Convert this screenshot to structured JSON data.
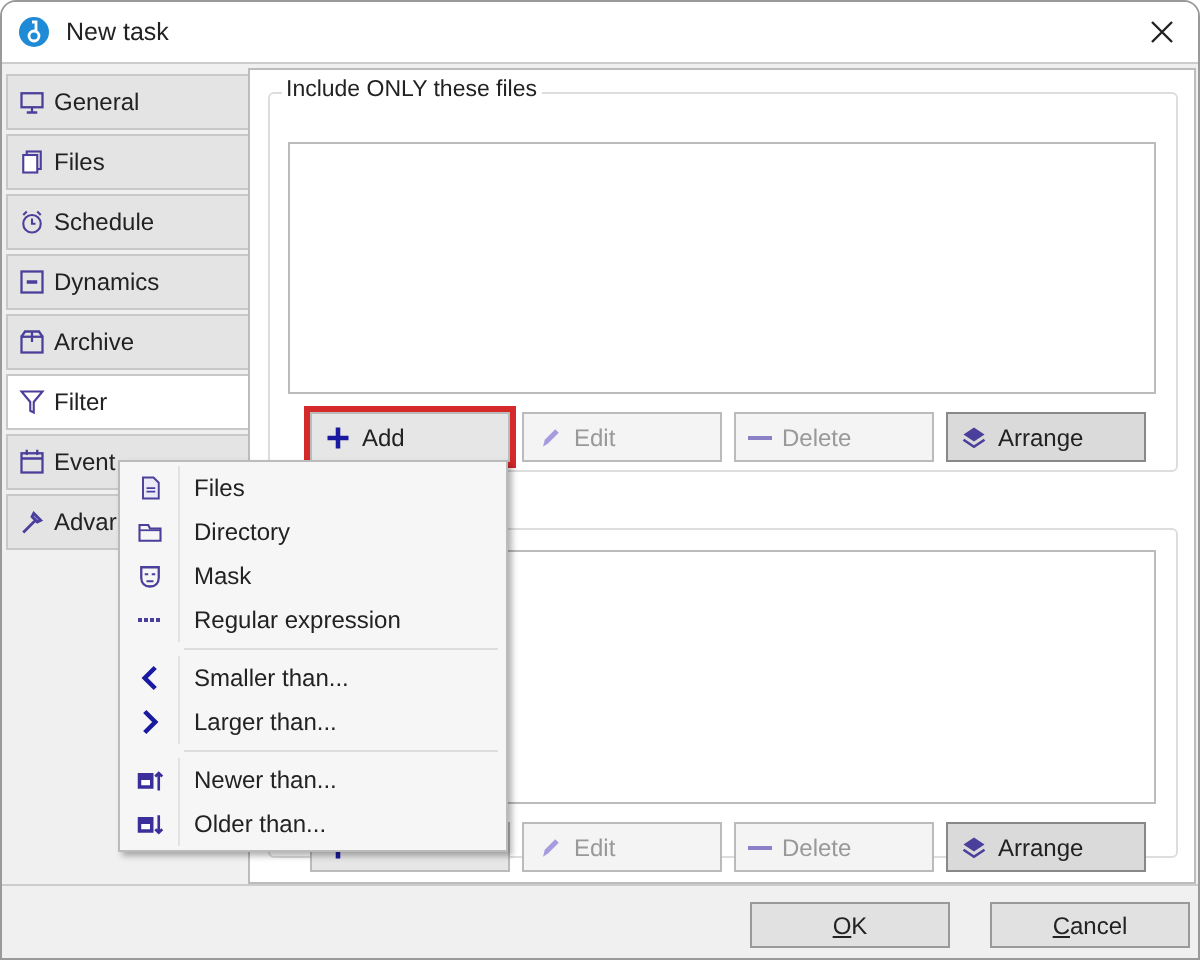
{
  "window": {
    "title": "New task"
  },
  "tabs": [
    {
      "label": "General",
      "selected": false
    },
    {
      "label": "Files",
      "selected": false
    },
    {
      "label": "Schedule",
      "selected": false
    },
    {
      "label": "Dynamics",
      "selected": false
    },
    {
      "label": "Archive",
      "selected": false
    },
    {
      "label": "Filter",
      "selected": true
    },
    {
      "label": "Event",
      "selected": false
    },
    {
      "label": "Advar",
      "selected": false
    }
  ],
  "include_group": {
    "title": "Include ONLY these files",
    "buttons": [
      {
        "label": "Add",
        "disabled": false,
        "highlighted": true
      },
      {
        "label": "Edit",
        "disabled": true,
        "highlighted": false
      },
      {
        "label": "Delete",
        "disabled": true,
        "highlighted": false
      },
      {
        "label": "Arrange",
        "disabled": false,
        "highlighted": false
      }
    ]
  },
  "second_group": {
    "buttons": [
      {
        "disabled": false,
        "highlighted": false
      },
      {
        "label": "Edit",
        "disabled": true,
        "highlighted": false
      },
      {
        "label": "Delete",
        "disabled": true,
        "highlighted": false
      },
      {
        "label": "Arrange",
        "disabled": false,
        "highlighted": false
      }
    ]
  },
  "add_menu": {
    "items": [
      {
        "kind": "item",
        "label": "Files"
      },
      {
        "kind": "item",
        "label": "Directory"
      },
      {
        "kind": "item",
        "label": "Mask"
      },
      {
        "kind": "item",
        "label": "Regular expression"
      },
      {
        "kind": "separator"
      },
      {
        "kind": "item",
        "label": "Smaller than..."
      },
      {
        "kind": "item",
        "label": "Larger than..."
      },
      {
        "kind": "separator"
      },
      {
        "kind": "item",
        "label": "Newer than..."
      },
      {
        "kind": "item",
        "label": "Older than..."
      }
    ]
  },
  "footer_buttons": [
    {
      "access_key": "O",
      "label_rest": "K"
    },
    {
      "access_key": "C",
      "label_rest": "ancel"
    }
  ]
}
